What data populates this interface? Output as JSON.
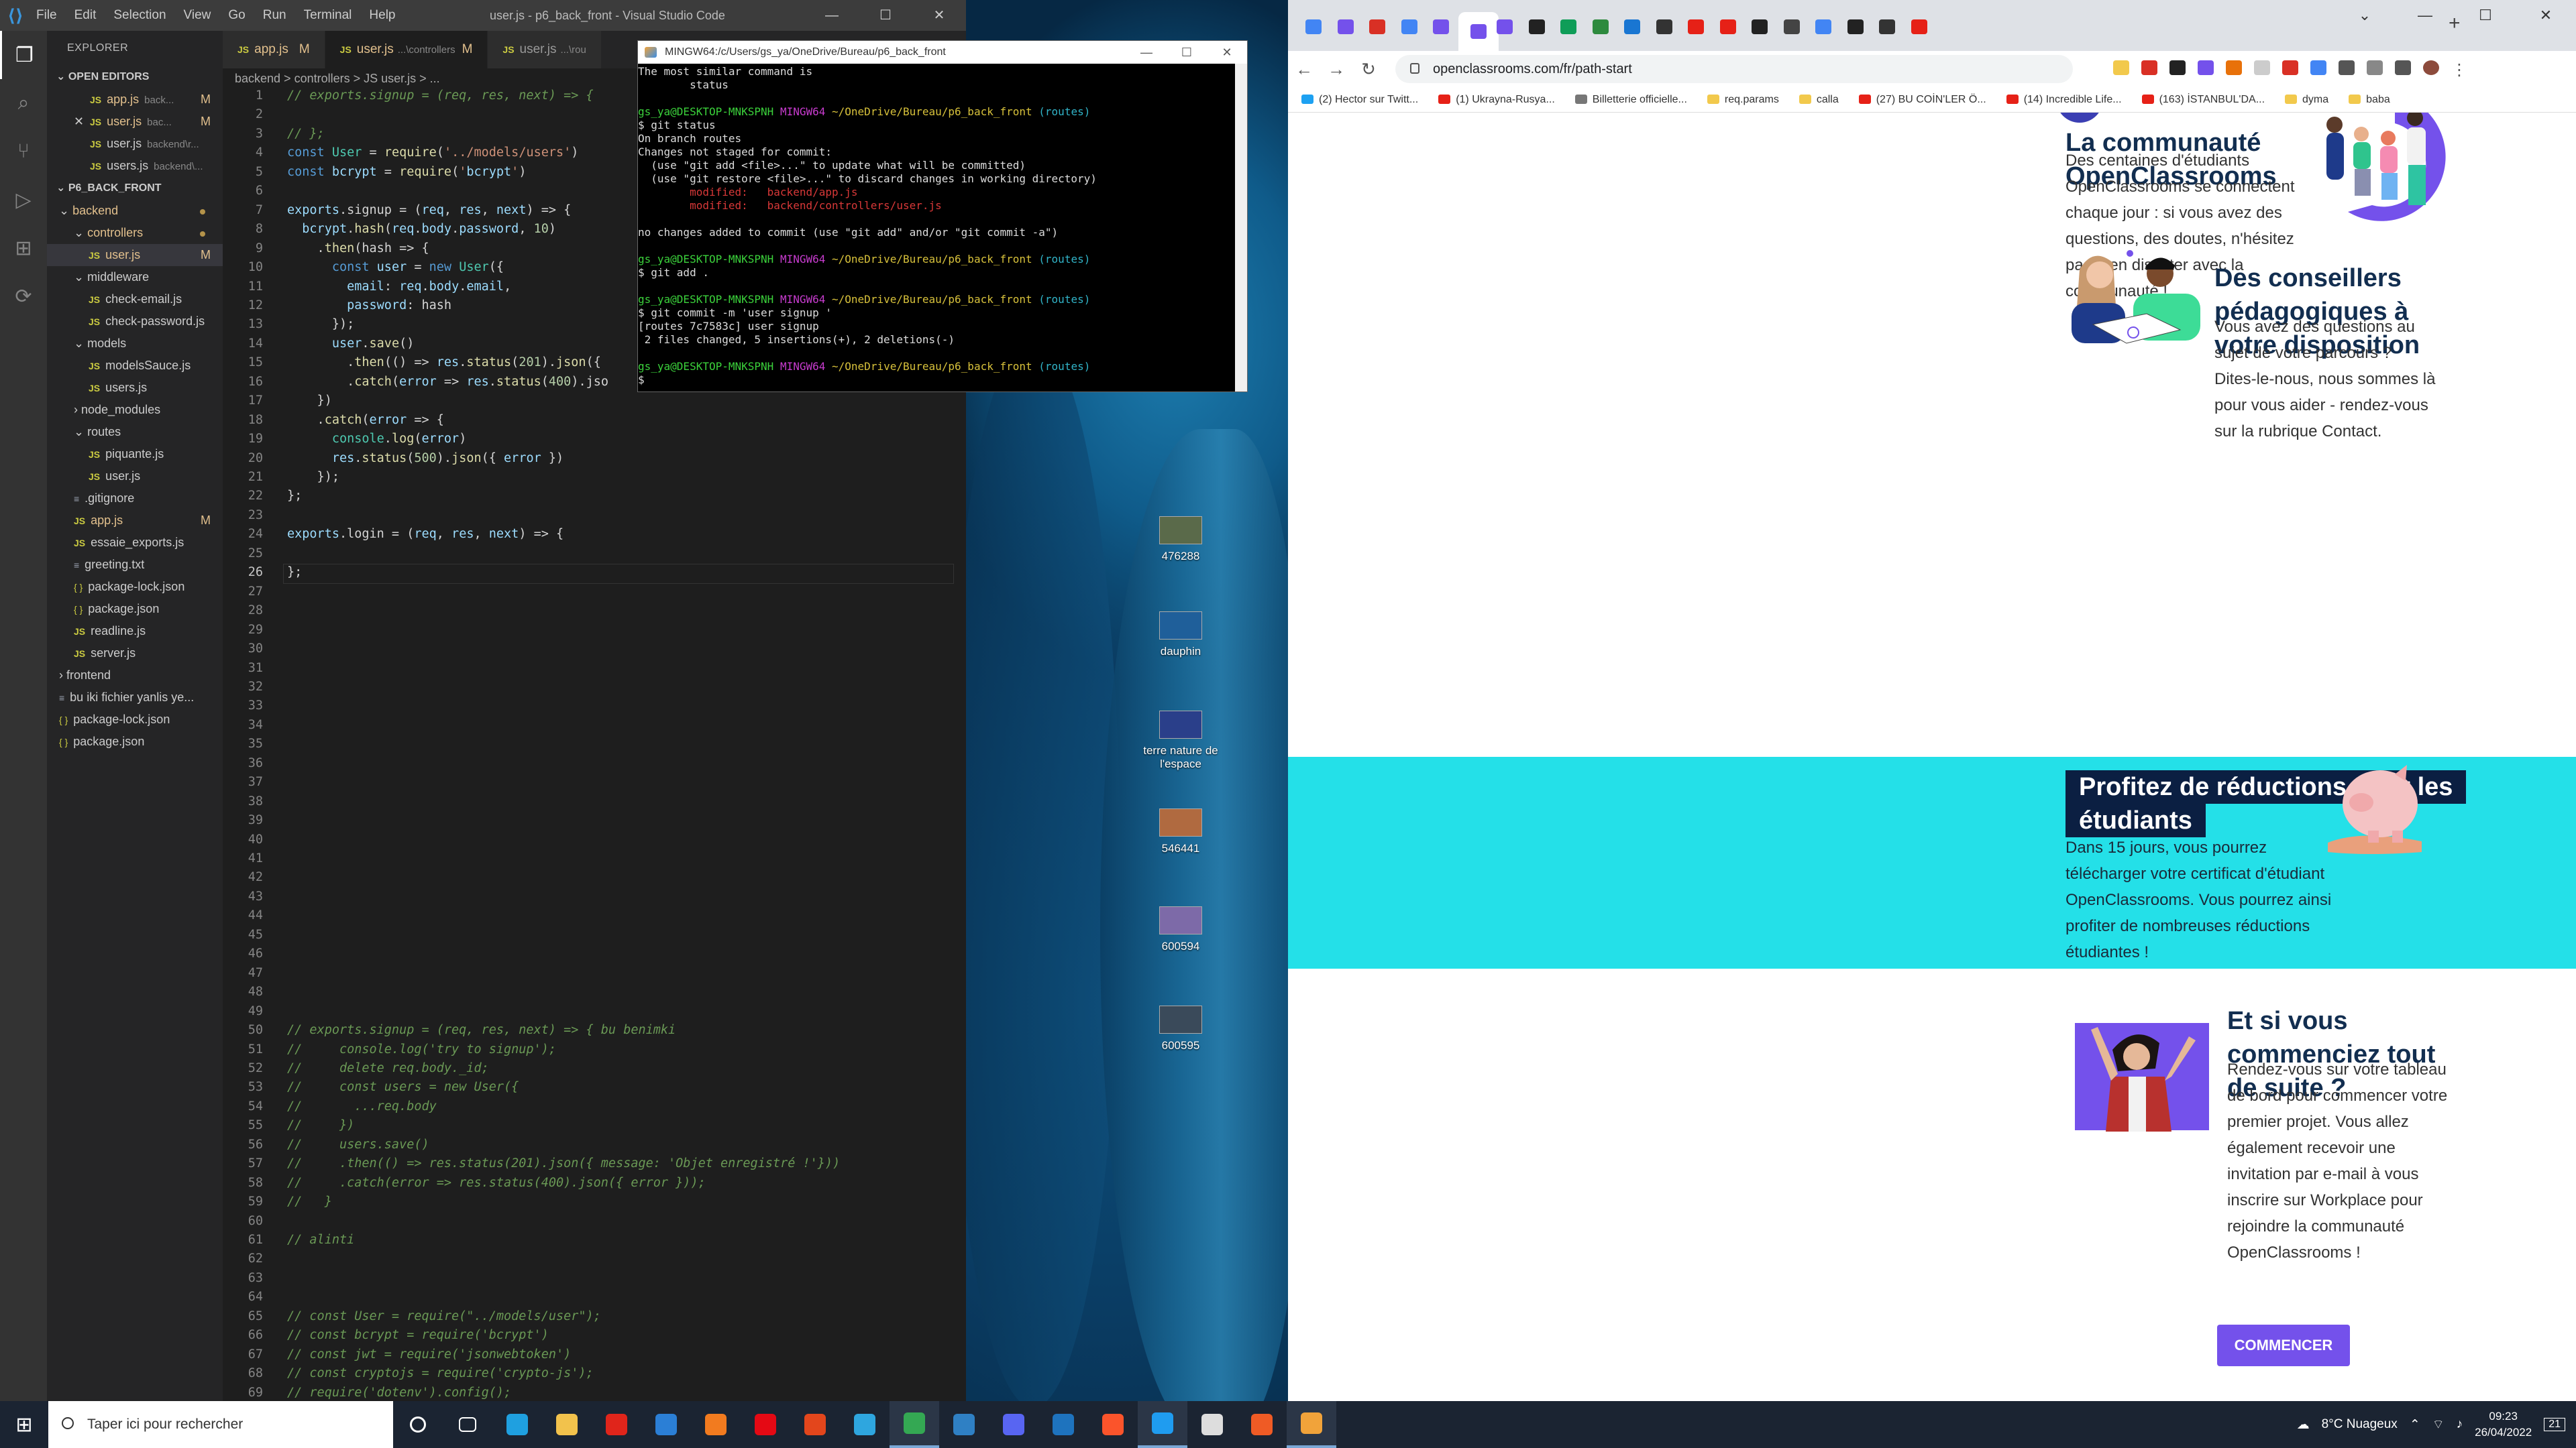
{
  "desktop": {
    "icons": [
      {
        "label": "476288"
      },
      {
        "label": "dauphin"
      },
      {
        "label": "terre nature de l'espace"
      },
      {
        "label": "546441"
      },
      {
        "label": "600594"
      },
      {
        "label": "600595"
      }
    ]
  },
  "vscode": {
    "menu": [
      "File",
      "Edit",
      "Selection",
      "View",
      "Go",
      "Run",
      "Terminal",
      "Help"
    ],
    "window_title": "user.js - p6_back_front - Visual Studio Code",
    "explorer_label": "EXPLORER",
    "open_editors_label": "OPEN EDITORS",
    "open_editors": [
      {
        "icon": "JS",
        "name": "app.js",
        "path": "back...",
        "status": "M"
      },
      {
        "icon": "JS",
        "name": "user.js",
        "path": "bac...",
        "status": "M"
      },
      {
        "icon": "JS",
        "name": "user.js",
        "path": "backend\\r...",
        "status": ""
      },
      {
        "icon": "JS",
        "name": "users.js",
        "path": "backend\\...",
        "status": ""
      }
    ],
    "project_label": "P6_BACK_FRONT",
    "tree": [
      {
        "name": "backend",
        "type": "folder",
        "depth": 0,
        "status": "dot"
      },
      {
        "name": "controllers",
        "type": "folder",
        "depth": 1,
        "status": "dot"
      },
      {
        "name": "user.js",
        "type": "js",
        "depth": 2,
        "status": "M",
        "selected": true
      },
      {
        "name": "middleware",
        "type": "folder",
        "depth": 1,
        "status": ""
      },
      {
        "name": "check-email.js",
        "type": "js",
        "depth": 2,
        "status": ""
      },
      {
        "name": "check-password.js",
        "type": "js",
        "depth": 2,
        "status": ""
      },
      {
        "name": "models",
        "type": "folder",
        "depth": 1,
        "status": ""
      },
      {
        "name": "modelsSauce.js",
        "type": "js",
        "depth": 2,
        "status": ""
      },
      {
        "name": "users.js",
        "type": "js",
        "depth": 2,
        "status": ""
      },
      {
        "name": "node_modules",
        "type": "folder-closed",
        "depth": 1,
        "status": ""
      },
      {
        "name": "routes",
        "type": "folder",
        "depth": 1,
        "status": ""
      },
      {
        "name": "piquante.js",
        "type": "js",
        "depth": 2,
        "status": ""
      },
      {
        "name": "user.js",
        "type": "js",
        "depth": 2,
        "status": ""
      },
      {
        "name": ".gitignore",
        "type": "txt",
        "depth": 1,
        "status": ""
      },
      {
        "name": "app.js",
        "type": "js",
        "depth": 1,
        "status": "M"
      },
      {
        "name": "essaie_exports.js",
        "type": "js",
        "depth": 1,
        "status": ""
      },
      {
        "name": "greeting.txt",
        "type": "txt",
        "depth": 1,
        "status": ""
      },
      {
        "name": "package-lock.json",
        "type": "json",
        "depth": 1,
        "status": ""
      },
      {
        "name": "package.json",
        "type": "json",
        "depth": 1,
        "status": ""
      },
      {
        "name": "readline.js",
        "type": "js",
        "depth": 1,
        "status": ""
      },
      {
        "name": "server.js",
        "type": "js",
        "depth": 1,
        "status": ""
      },
      {
        "name": "frontend",
        "type": "folder-closed",
        "depth": 0,
        "status": ""
      },
      {
        "name": "bu iki fichier yanlis ye...",
        "type": "txt",
        "depth": 0,
        "status": ""
      },
      {
        "name": "package-lock.json",
        "type": "json",
        "depth": 0,
        "status": ""
      },
      {
        "name": "package.json",
        "type": "json",
        "depth": 0,
        "status": ""
      }
    ],
    "tabs": [
      {
        "name": "app.js",
        "extra": "",
        "status": "M"
      },
      {
        "name": "user.js",
        "extra": "...\\controllers",
        "status": "M"
      },
      {
        "name": "user.js",
        "extra": "...\\rou",
        "status": ""
      }
    ],
    "breadcrumb": "backend  >  controllers  >  JS user.js  >  ...",
    "code_top": [
      {
        "n": "1",
        "code": "// exports.signup = (req, res, next) => {"
      },
      {
        "n": "2",
        "code": ""
      },
      {
        "n": "3",
        "code": "// };"
      },
      {
        "n": "4",
        "code": "const User = require('../models/users')"
      },
      {
        "n": "5",
        "code": "const bcrypt = require('bcrypt')"
      },
      {
        "n": "6",
        "code": ""
      },
      {
        "n": "7",
        "code": "exports.signup = (req, res, next) => {"
      },
      {
        "n": "8",
        "code": "  bcrypt.hash(req.body.password, 10)"
      },
      {
        "n": "9",
        "code": "    .then(hash => {"
      },
      {
        "n": "10",
        "code": "      const user = new User({"
      },
      {
        "n": "11",
        "code": "        email: req.body.email,"
      },
      {
        "n": "12",
        "code": "        password: hash"
      },
      {
        "n": "13",
        "code": "      });"
      },
      {
        "n": "14",
        "code": "      user.save()"
      },
      {
        "n": "15",
        "code": "        .then(() => res.status(201).json({"
      },
      {
        "n": "16",
        "code": "        .catch(error => res.status(400).jso"
      },
      {
        "n": "17",
        "code": "    })"
      },
      {
        "n": "18",
        "code": "    .catch(error => {"
      },
      {
        "n": "19",
        "code": "      console.log(error)"
      },
      {
        "n": "20",
        "code": "      res.status(500).json({ error })"
      },
      {
        "n": "21",
        "code": "    });"
      },
      {
        "n": "22",
        "code": "};"
      },
      {
        "n": "23",
        "code": ""
      },
      {
        "n": "24",
        "code": "exports.login = (req, res, next) => {"
      },
      {
        "n": "25",
        "code": ""
      },
      {
        "n": "26",
        "code": "};"
      },
      {
        "n": "27",
        "code": ""
      },
      {
        "n": "28",
        "code": ""
      },
      {
        "n": "29",
        "code": ""
      },
      {
        "n": "30",
        "code": ""
      },
      {
        "n": "31",
        "code": ""
      },
      {
        "n": "32",
        "code": ""
      },
      {
        "n": "33",
        "code": ""
      },
      {
        "n": "34",
        "code": ""
      },
      {
        "n": "35",
        "code": ""
      },
      {
        "n": "36",
        "code": ""
      },
      {
        "n": "37",
        "code": ""
      },
      {
        "n": "38",
        "code": ""
      },
      {
        "n": "39",
        "code": ""
      },
      {
        "n": "40",
        "code": ""
      },
      {
        "n": "41",
        "code": ""
      },
      {
        "n": "42",
        "code": ""
      },
      {
        "n": "43",
        "code": ""
      },
      {
        "n": "44",
        "code": ""
      },
      {
        "n": "45",
        "code": ""
      },
      {
        "n": "46",
        "code": ""
      },
      {
        "n": "47",
        "code": ""
      },
      {
        "n": "48",
        "code": ""
      },
      {
        "n": "49",
        "code": ""
      },
      {
        "n": "50",
        "code": "// exports.signup = (req, res, next) => { bu benimki"
      },
      {
        "n": "51",
        "code": "//     console.log('try to signup');"
      },
      {
        "n": "52",
        "code": "//     delete req.body._id;"
      },
      {
        "n": "53",
        "code": "//     const users = new User({"
      },
      {
        "n": "54",
        "code": "//       ...req.body"
      },
      {
        "n": "55",
        "code": "//     })"
      },
      {
        "n": "56",
        "code": "//     users.save()"
      },
      {
        "n": "57",
        "code": "//     .then(() => res.status(201).json({ message: 'Objet enregistré !'}))"
      },
      {
        "n": "58",
        "code": "//     .catch(error => res.status(400).json({ error }));"
      },
      {
        "n": "59",
        "code": "//   }"
      },
      {
        "n": "60",
        "code": ""
      },
      {
        "n": "61",
        "code": "// alinti"
      },
      {
        "n": "62",
        "code": ""
      },
      {
        "n": "63",
        "code": ""
      },
      {
        "n": "64",
        "code": ""
      },
      {
        "n": "65",
        "code": "// const User = require(\"../models/user\");"
      },
      {
        "n": "66",
        "code": "// const bcrypt = require('bcrypt')"
      },
      {
        "n": "67",
        "code": "// const jwt = require('jsonwebtoken')"
      },
      {
        "n": "68",
        "code": "// const cryptojs = require('crypto-js');"
      },
      {
        "n": "69",
        "code": "// require('dotenv').config();"
      }
    ]
  },
  "terminal": {
    "title": "MINGW64:/c/Users/gs_ya/OneDrive/Bureau/p6_back_front",
    "lines": [
      {
        "cls": "",
        "text": "The most similar command is"
      },
      {
        "cls": "",
        "text": "        status"
      },
      {
        "cls": "",
        "text": ""
      },
      {
        "cls": "prompt",
        "text": "gs_ya@DESKTOP-MNKSPNH MINGW64 ~/OneDrive/Bureau/p6_back_front (routes)"
      },
      {
        "cls": "",
        "text": "$ git status"
      },
      {
        "cls": "",
        "text": "On branch routes"
      },
      {
        "cls": "",
        "text": "Changes not staged for commit:"
      },
      {
        "cls": "",
        "text": "  (use \"git add <file>...\" to update what will be committed)"
      },
      {
        "cls": "",
        "text": "  (use \"git restore <file>...\" to discard changes in working directory)"
      },
      {
        "cls": "tr",
        "text": "        modified:   backend/app.js"
      },
      {
        "cls": "tr",
        "text": "        modified:   backend/controllers/user.js"
      },
      {
        "cls": "",
        "text": ""
      },
      {
        "cls": "",
        "text": "no changes added to commit (use \"git add\" and/or \"git commit -a\")"
      },
      {
        "cls": "",
        "text": ""
      },
      {
        "cls": "prompt",
        "text": "gs_ya@DESKTOP-MNKSPNH MINGW64 ~/OneDrive/Bureau/p6_back_front (routes)"
      },
      {
        "cls": "",
        "text": "$ git add ."
      },
      {
        "cls": "",
        "text": ""
      },
      {
        "cls": "prompt",
        "text": "gs_ya@DESKTOP-MNKSPNH MINGW64 ~/OneDrive/Bureau/p6_back_front (routes)"
      },
      {
        "cls": "",
        "text": "$ git commit -m 'user signup '"
      },
      {
        "cls": "",
        "text": "[routes 7c7583c] user signup"
      },
      {
        "cls": "",
        "text": " 2 files changed, 5 insertions(+), 2 deletions(-)"
      },
      {
        "cls": "",
        "text": ""
      },
      {
        "cls": "prompt",
        "text": "gs_ya@DESKTOP-MNKSPNH MINGW64 ~/OneDrive/Bureau/p6_back_front (routes)"
      },
      {
        "cls": "",
        "text": "$"
      }
    ]
  },
  "chrome": {
    "tabs": [
      {
        "label": "G",
        "color": "#4285f4"
      },
      {
        "label": "C",
        "color": "#7451eb"
      },
      {
        "label": "Ri",
        "color": "#d93025"
      },
      {
        "label": "G",
        "color": "#4285f4"
      },
      {
        "label": "C",
        "color": "#7451eb"
      },
      {
        "label": "x",
        "color": "#7451eb",
        "active": true
      },
      {
        "label": "Vi",
        "color": "#7451eb"
      },
      {
        "label": "H",
        "color": "#222222"
      },
      {
        "label": "D",
        "color": "#0f9d58"
      },
      {
        "label": "Fi",
        "color": "#2d8a3e"
      },
      {
        "label": "D",
        "color": "#1976d2"
      },
      {
        "label": "Ex",
        "color": "#333333"
      },
      {
        "label": "st",
        "color": "#e62117"
      },
      {
        "label": "Yc",
        "color": "#e62117"
      },
      {
        "label": "Vi",
        "color": "#222222"
      },
      {
        "label": "Cl",
        "color": "#444444"
      },
      {
        "label": "lu",
        "color": "#4285f4"
      },
      {
        "label": "oi",
        "color": "#222222"
      },
      {
        "label": "Ex",
        "color": "#333333"
      },
      {
        "label": "(E",
        "color": "#e62117"
      }
    ],
    "url": "openclassrooms.com/fr/path-start",
    "bookmarks": [
      {
        "label": "(2) Hector sur Twitt...",
        "color": "#1da1f2"
      },
      {
        "label": "(1) Ukrayna-Rusya...",
        "color": "#e62117"
      },
      {
        "label": "Billetterie officielle...",
        "color": "#777777"
      },
      {
        "label": "req.params",
        "color": "#f2c94c"
      },
      {
        "label": "calla",
        "color": "#f2c94c"
      },
      {
        "label": "(27) BU COİN'LER Ö...",
        "color": "#e62117"
      },
      {
        "label": "(14) Incredible Life...",
        "color": "#e62117"
      },
      {
        "label": "(163) İSTANBUL'DA...",
        "color": "#e62117"
      },
      {
        "label": "dyma",
        "color": "#f2c94c"
      },
      {
        "label": "baba",
        "color": "#f2c94c"
      }
    ],
    "page": {
      "community": {
        "title": "La communauté OpenClassrooms",
        "text": "Des centaines d'étudiants OpenClassrooms se connectent chaque jour : si vous avez des questions, des doutes, n'hésitez pas à en discuter avec la communauté !"
      },
      "advisors": {
        "title": "Des conseillers pédagogiques à votre disposition",
        "text": "Vous avez des questions au sujet de votre parcours ? Dites-le-nous, nous sommes là pour vous aider - rendez-vous sur la rubrique Contact."
      },
      "discounts": {
        "title_line1": "Profitez de réductions pour les",
        "title_line2": "étudiants",
        "text": "Dans 15 jours, vous pourrez télécharger votre certificat d'étudiant OpenClassrooms. Vous pourrez ainsi profiter de nombreuses réductions étudiantes !"
      },
      "start": {
        "title": "Et si vous commenciez tout de suite ?",
        "text": "Rendez-vous sur votre tableau de bord pour commencer votre premier projet. Vous allez également recevoir une invitation par e-mail à vous inscrire sur Workplace pour rejoindre la communauté OpenClassrooms !"
      },
      "cta_label": "COMMENCER"
    }
  },
  "taskbar": {
    "search_placeholder": "Taper ici pour rechercher",
    "apps": [
      {
        "name": "cortana",
        "color": "#ffffff",
        "active": false
      },
      {
        "name": "task-view",
        "color": "#ffffff",
        "active": false
      },
      {
        "name": "edge",
        "color": "#1fa0e0",
        "active": false
      },
      {
        "name": "file-explorer",
        "color": "#f2c24c",
        "active": false
      },
      {
        "name": "opera",
        "color": "#e0251b",
        "active": false
      },
      {
        "name": "mail",
        "color": "#2b7fd6",
        "active": false
      },
      {
        "name": "firefox",
        "color": "#f27b1f",
        "active": false
      },
      {
        "name": "netflix",
        "color": "#e50914",
        "active": false
      },
      {
        "name": "office",
        "color": "#e3461c",
        "active": false
      },
      {
        "name": "telegram",
        "color": "#2ea6df",
        "active": false
      },
      {
        "name": "chrome",
        "color": "#34a853",
        "active": true
      },
      {
        "name": "app-blue",
        "color": "#2f80c4",
        "active": false
      },
      {
        "name": "discord",
        "color": "#5865f2",
        "active": false
      },
      {
        "name": "app-tablet",
        "color": "#1e73be",
        "active": false
      },
      {
        "name": "brave",
        "color": "#fb542b",
        "active": false
      },
      {
        "name": "vscode",
        "color": "#1f9cf0",
        "active": true
      },
      {
        "name": "settings",
        "color": "#dddddd",
        "active": false
      },
      {
        "name": "postman",
        "color": "#ef5b25",
        "active": false
      },
      {
        "name": "git-bash",
        "color": "#f1a33a",
        "active": true
      }
    ],
    "weather": "8°C  Nuageux",
    "time": "09:23",
    "date": "26/04/2022",
    "notif_count": "21"
  }
}
